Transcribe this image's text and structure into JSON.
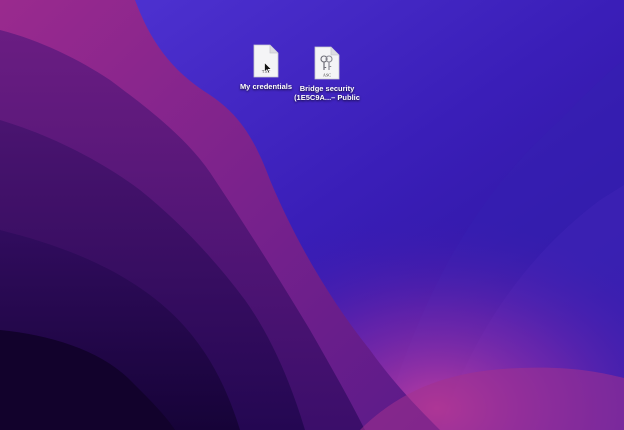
{
  "desktop": {
    "wallpaper_colors": {
      "sky_top": "#4b2fd0",
      "sky_bottom": "#2a14a0",
      "ridge_magenta": "#7a1f8c",
      "deep_purple": "#2a0a5e",
      "glow_pink": "#c23a9a"
    },
    "icons": [
      {
        "label": "My credentials",
        "badge": "TXT",
        "icon": "text-file-icon"
      },
      {
        "label_line1": "Bridge security",
        "label_line2": "(1E5C9A...– Public",
        "badge": "ASC",
        "icon": "certificate-file-icon"
      }
    ]
  }
}
